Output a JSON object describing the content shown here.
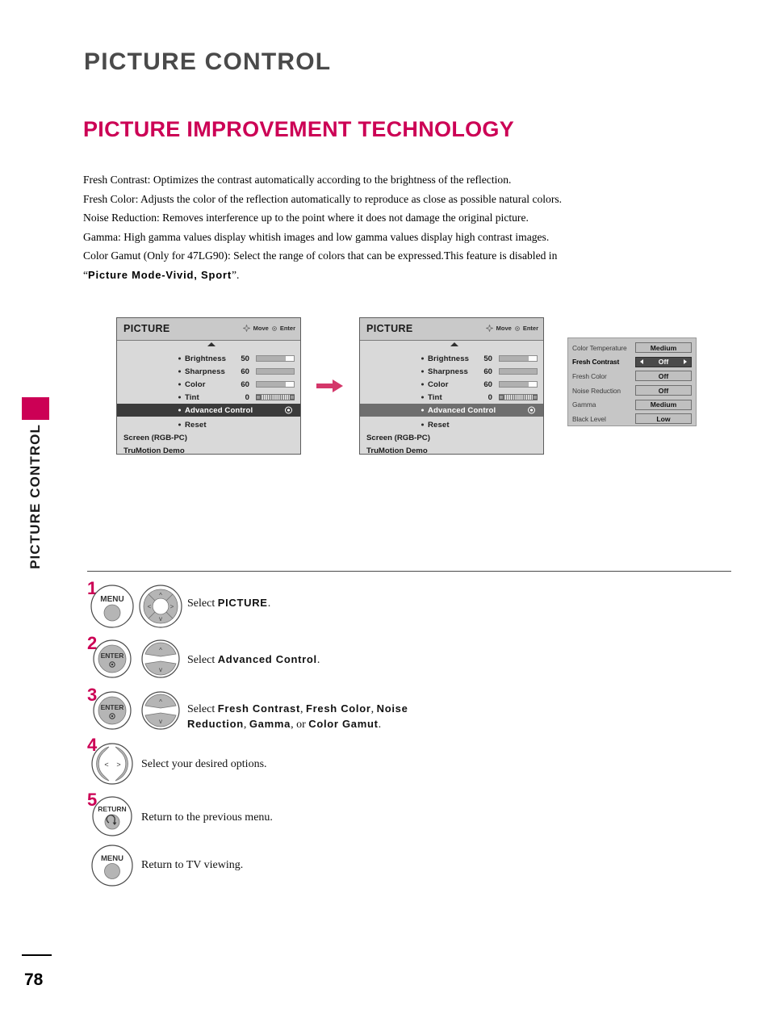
{
  "page": {
    "title": "PICTURE CONTROL",
    "section_title": "PICTURE IMPROVEMENT TECHNOLOGY",
    "side_tab_text": "PICTURE CONTROL",
    "page_number": "78"
  },
  "body": {
    "line1": "Fresh Contrast: Optimizes the contrast automatically according to the brightness of the reflection.",
    "line2": "Fresh Color: Adjusts the color of the reflection automatically to reproduce as close as possible natural colors.",
    "line3": "Noise Reduction: Removes interference up to the point where it does not damage the original picture.",
    "line4": "Gamma: High gamma values display whitish images and low gamma values display high contrast images.",
    "line5a": "Color Gamut (Only for 47LG90): Select the range of colors that can be expressed.This feature is disabled in",
    "line5_quote_open": "“",
    "line5_emph": "Picture Mode-Vivid, Sport",
    "line5_quote_close": "”."
  },
  "osd": {
    "title": "PICTURE",
    "hint_move": "Move",
    "hint_enter": "Enter",
    "rows": [
      {
        "label": "Brightness",
        "value": "50",
        "bar": true,
        "fill_pct": 52,
        "mid_pct": 78
      },
      {
        "label": "Sharpness",
        "value": "60",
        "bar": true,
        "fill_pct": 62,
        "mid_pct": 100
      },
      {
        "label": "Color",
        "value": "60",
        "bar": true,
        "fill_pct": 62,
        "mid_pct": 78
      },
      {
        "label": "Tint",
        "value": "0",
        "bar": false,
        "tint": true
      }
    ],
    "advanced_control": "Advanced Control",
    "reset": "Reset",
    "screen": "Screen (RGB-PC)",
    "trumotion": "TruMotion Demo"
  },
  "settings_panel": {
    "rows": [
      {
        "name": "Color Temperature",
        "value": "Medium",
        "active": false
      },
      {
        "name": "Fresh Contrast",
        "value": "Off",
        "active": true
      },
      {
        "name": "Fresh Color",
        "value": "Off",
        "active": false
      },
      {
        "name": "Noise Reduction",
        "value": "Off",
        "active": false
      },
      {
        "name": "Gamma",
        "value": "Medium",
        "active": false
      },
      {
        "name": "Black Level",
        "value": "Low",
        "active": false
      }
    ]
  },
  "steps": {
    "s1": {
      "num": "1",
      "btn": "MENU",
      "text_prefix": "Select ",
      "text_emph": "PICTURE",
      "text_suffix": "."
    },
    "s2": {
      "num": "2",
      "btn": "ENTER",
      "text_prefix": "Select ",
      "text_emph": "Advanced Control",
      "text_suffix": "."
    },
    "s3": {
      "num": "3",
      "btn": "ENTER",
      "text_prefix": "Select ",
      "emph1": "Fresh  Contrast",
      "sep1": ", ",
      "emph2": "Fresh  Color",
      "sep2": ", ",
      "emph3": "Noise Reduction",
      "sep3": ", ",
      "emph4": "Gamma",
      "sep4": ", or ",
      "emph5": "Color Gamut",
      "text_suffix": "."
    },
    "s4": {
      "num": "4",
      "text": "Select your desired options."
    },
    "s5": {
      "num": "5",
      "btn": "RETURN",
      "text": "Return to the previous menu."
    },
    "s6": {
      "btn": "MENU",
      "text": "Return to TV viewing."
    }
  },
  "colors": {
    "accent": "#cc0055",
    "title_gray": "#4a4a4a",
    "osd_bg": "#d9d9d9",
    "osd_header": "#c9c9c9",
    "highlight_dark": "#3b3b3b",
    "highlight_medium": "#6e6e6e",
    "settings_bg": "#c6c6c6"
  }
}
